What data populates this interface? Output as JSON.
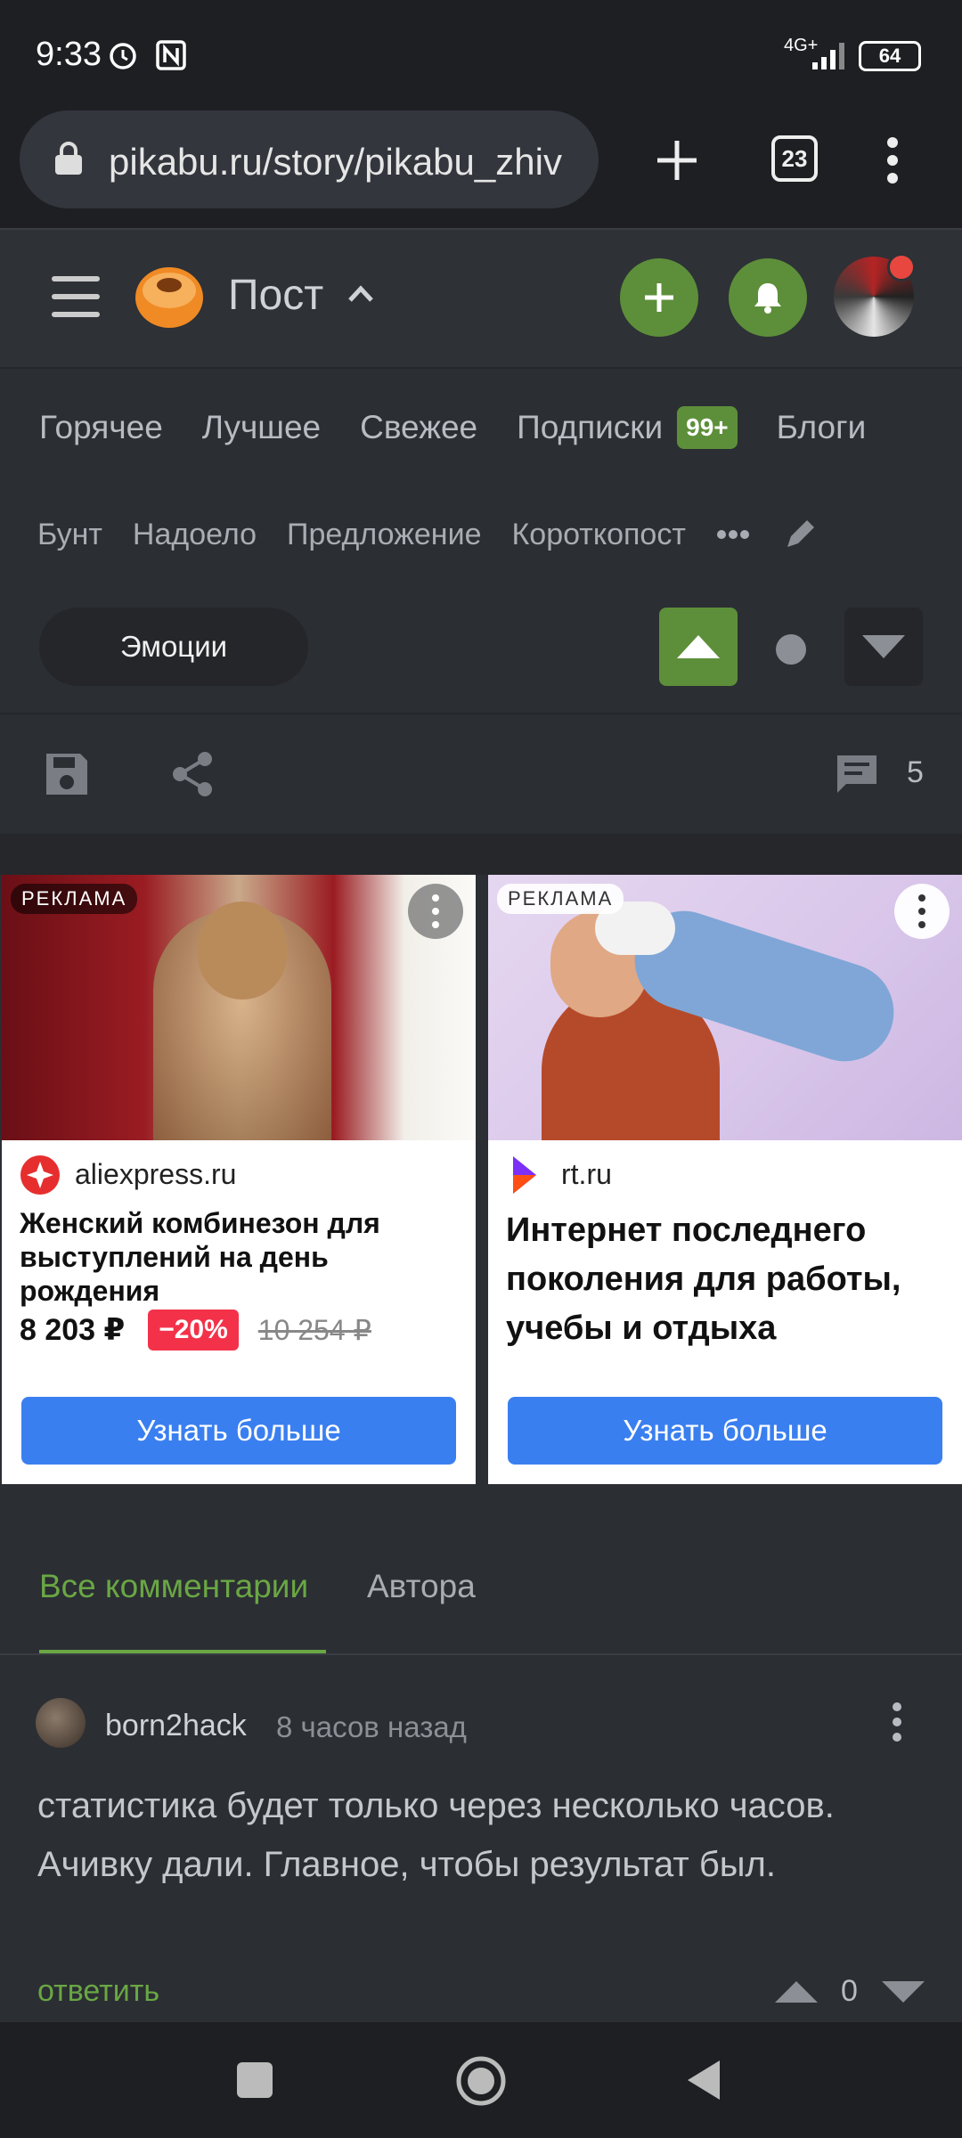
{
  "status_bar": {
    "time": "9:33",
    "network": "4G+",
    "battery": "64"
  },
  "browser": {
    "url": "pikabu.ru/story/pikabu_zhiv",
    "tabs_count": "23"
  },
  "header": {
    "title": "Пост"
  },
  "nav": {
    "items": [
      "Горячее",
      "Лучшее",
      "Свежее",
      "Подписки",
      "Блоги"
    ],
    "subscriptions_badge": "99+"
  },
  "tags": [
    "Бунт",
    "Надоело",
    "Предложение",
    "Короткопост"
  ],
  "post_actions": {
    "emotions_label": "Эмоции",
    "comments_count": "5"
  },
  "ads": [
    {
      "badge": "РЕКЛАМА",
      "domain": "aliexpress.ru",
      "title": "Женский комбинезон для выступлений на день рождения",
      "price": "8 203 ₽",
      "discount": "−20%",
      "old_price": "10 254 ₽",
      "cta": "Узнать больше"
    },
    {
      "badge": "РЕКЛАМА",
      "domain": "rt.ru",
      "title": "Интернет последнего поколения для работы, учебы и отдыха",
      "cta": "Узнать больше"
    }
  ],
  "comment_tabs": {
    "all": "Все комментарии",
    "author": "Автора"
  },
  "comment": {
    "author": "born2hack",
    "time": "8 часов назад",
    "text": "статистика будет только через несколько часов. Ачивку дали.  Главное, чтобы результат был.",
    "reply": "ответить",
    "rating": "0"
  },
  "colors": {
    "accent": "#5d8f3a",
    "cta": "#3a7ff0",
    "discount": "#f3324a"
  }
}
